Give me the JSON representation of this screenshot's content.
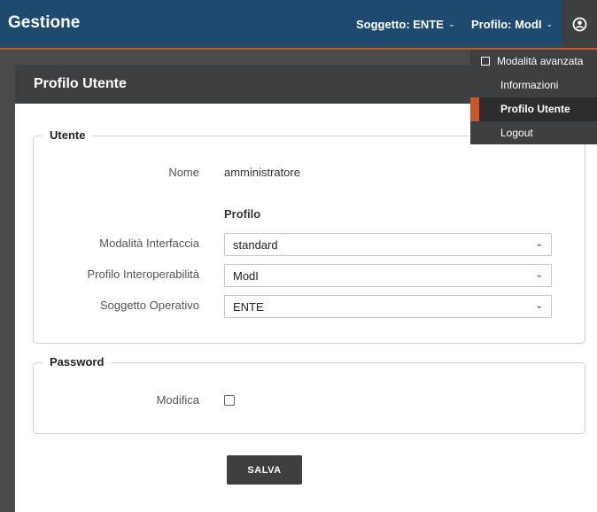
{
  "app": {
    "title": "Gestione"
  },
  "nav": {
    "soggetto_label": "Soggetto: ENTE",
    "profilo_label": "Profilo: ModI"
  },
  "dropdown": {
    "items": [
      {
        "label": "Modalità avanzata",
        "type": "checkbox",
        "checked": false
      },
      {
        "label": "Informazioni"
      },
      {
        "label": "Profilo Utente",
        "active": true
      },
      {
        "label": "Logout"
      }
    ]
  },
  "panel": {
    "title": "Profilo Utente"
  },
  "utente": {
    "legend": "Utente",
    "nome_label": "Nome",
    "nome_value": "amministratore",
    "profilo_heading": "Profilo",
    "fields": [
      {
        "label": "Modalità Interfaccia",
        "value": "standard"
      },
      {
        "label": "Profilo Interoperabilità",
        "value": "ModI"
      },
      {
        "label": "Soggetto Operativo",
        "value": "ENTE"
      }
    ]
  },
  "password": {
    "legend": "Password",
    "modifica_label": "Modifica",
    "modifica_checked": false
  },
  "actions": {
    "save_label": "SALVA"
  },
  "colors": {
    "topbar": "#1d4a6e",
    "accent": "#c9572a",
    "dark": "#3e3f40"
  }
}
